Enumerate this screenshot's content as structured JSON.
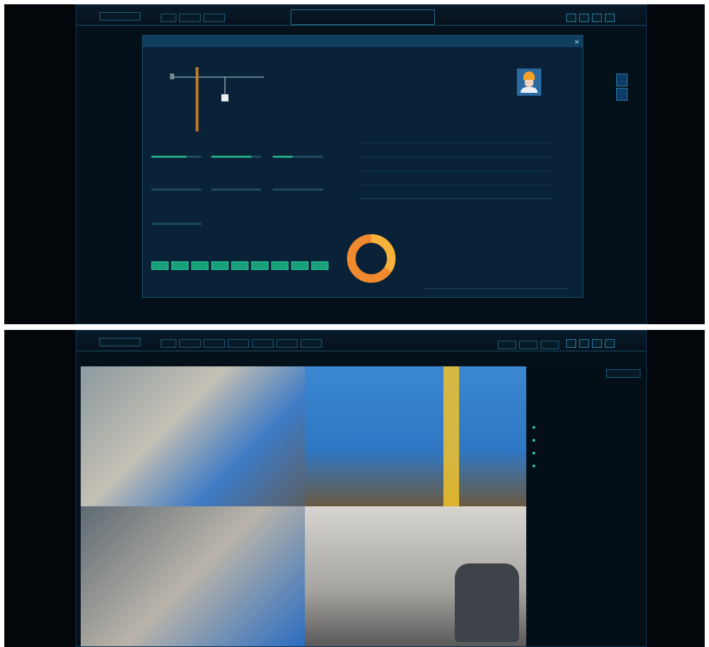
{
  "top": {
    "app_title": "",
    "nav_items": [
      "",
      "",
      ""
    ],
    "breadcrumb": "",
    "modal": {
      "title": "",
      "tower_section_title": "",
      "worker_section_title": "",
      "chart_section_title": "",
      "donut_section_title": "",
      "alarm_label": "",
      "worker_fields": [
        "",
        "",
        "",
        ""
      ],
      "worker_values": [
        "",
        "",
        "",
        ""
      ],
      "operator_fields": [
        "",
        "",
        "",
        ""
      ],
      "buttons": [
        "",
        "",
        "",
        "",
        "",
        "",
        "",
        "",
        ""
      ]
    },
    "colors": {
      "accent": "#21a984",
      "bg": "#050d15",
      "line": "#8ad0ff",
      "bar_main": "#f18a2e",
      "bar_top": "#f6b23a"
    }
  },
  "bottom": {
    "app_title": "",
    "center_title": "",
    "nav_items": [
      "",
      "",
      "",
      "",
      "",
      "",
      ""
    ],
    "right_buttons": [
      "",
      "",
      ""
    ],
    "breadcrumb": "",
    "right_panel": {
      "top_button": "",
      "tabs": [
        "",
        ""
      ],
      "filter": "",
      "device_list": [
        "",
        "",
        "",
        ""
      ],
      "pagination": [
        "",
        "",
        "",
        "",
        ""
      ]
    },
    "cameras": [
      {
        "label": ""
      },
      {
        "label": ""
      },
      {
        "label": ""
      },
      {
        "label": ""
      }
    ]
  },
  "icons": [
    "person-avatar-icon",
    "green-dot-icon",
    "settings-icon",
    "close-icon",
    "crane-icon"
  ]
}
